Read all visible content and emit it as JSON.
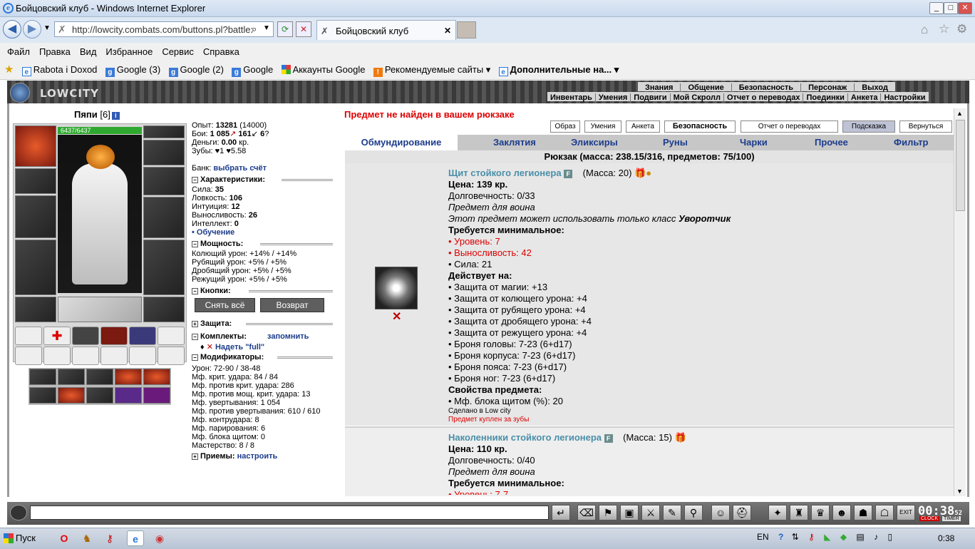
{
  "window": {
    "title": "Бойцовский клуб - Windows Internet Explorer",
    "min": "_",
    "max": "□",
    "close": "✕"
  },
  "browser": {
    "url": "http://lowcity.combats.com/buttons.pl?battle:",
    "tab": "Бойцовский клуб",
    "tab_close": "✕"
  },
  "menu": [
    "Файл",
    "Правка",
    "Вид",
    "Избранное",
    "Сервис",
    "Справка"
  ],
  "favorites": [
    {
      "label": "Rabota i Doxod",
      "icon": "page-icon"
    },
    {
      "label": "Google (3)",
      "icon": "google-icon"
    },
    {
      "label": "Google (2)",
      "icon": "google-icon"
    },
    {
      "label": "Google",
      "icon": "google-icon"
    },
    {
      "label": "Аккаунты Google",
      "icon": "google-accounts-icon"
    },
    {
      "label": "Рекомендуемые сайты ▾",
      "icon": "suggested-sites-icon"
    },
    {
      "label": "Дополнительные на...",
      "icon": "page-icon"
    }
  ],
  "game": {
    "logo": "LOWCITY",
    "top_menu": [
      "Знания",
      "Общение",
      "Безопасность",
      "Персонаж",
      "Выход"
    ],
    "sub_menu": [
      "Инвентарь",
      "Умения",
      "Подвиги",
      "Мой Скролл",
      "Отчет о переводах",
      "Поединки",
      "Анкета",
      "Настройки"
    ]
  },
  "character": {
    "name": "Пяпи",
    "level": "[6]",
    "hp": "6437/6437",
    "stats": {
      "exp_label": "Опыт:",
      "exp": "13281",
      "exp_next": "(14000)",
      "fights_label": "Бои:",
      "wins": "1 085",
      "losses": "161",
      "draws": "6",
      "money_label": "Деньги:",
      "money": "0.00",
      "money_unit": "кр.",
      "teeth_label": "Зубы:",
      "teeth": "1",
      "teeth2": "5.58",
      "bank_label": "Банк:",
      "bank_link": "выбрать счёт"
    },
    "sections": {
      "characteristics": "Характеристики:",
      "power": "Мощность:",
      "buttons": "Кнопки:",
      "defence": "Защита:",
      "sets": "Комплекты:",
      "sets_link": "запомнить",
      "wear_full": "Надеть \"full\"",
      "modifiers": "Модификаторы:",
      "techniques": "Приемы:",
      "techniques_link": "настроить"
    },
    "characteristics": [
      {
        "label": "Сила:",
        "value": "35"
      },
      {
        "label": "Ловкость:",
        "value": "106"
      },
      {
        "label": "Интуиция:",
        "value": "12"
      },
      {
        "label": "Выносливость:",
        "value": "26"
      },
      {
        "label": "Интеллект:",
        "value": "0"
      }
    ],
    "training_link": "• Обучение",
    "power": [
      "Колющий урон: +14% / +14%",
      "Рубящий урон: +5% / +5%",
      "Дробящий урон: +5% / +5%",
      "Режущий урон: +5% / +5%"
    ],
    "btn_remove_all": "Снять всё",
    "btn_return": "Возврат",
    "modifiers": [
      "Урон: 72-90 / 38-48",
      "Мф. крит. удара: 84 / 84",
      "Мф. против крит. удара: 286",
      "Мф. против мощ. крит. удара: 13",
      "Мф. увертывания: 1 054",
      "Мф. против увертывания: 610 / 610",
      "Мф. контрудара: 8",
      "Мф. парирования: 6",
      "Мф. блока щитом: 0",
      "Мастерство: 8 / 8"
    ]
  },
  "main": {
    "message": "Предмет не найден в вашем рюкзаке",
    "top_buttons": [
      "Образ",
      "Умения",
      "Анкета",
      "Безопасность",
      "Отчет о переводах",
      "Подсказка",
      "Вернуться"
    ],
    "categories": [
      "Обмундирование",
      "Заклятия",
      "Эликсиры",
      "Руны",
      "Чарки",
      "Прочее",
      "Фильтр"
    ],
    "rucksack": "Рюкзак (масса: 238.15/316, предметов: 75/100)",
    "item1": {
      "name": "Щит стойкого легионера",
      "f": "F",
      "mass": "(Масса: 20)",
      "price": "Цена: 139 кр.",
      "durability": "Долговечность: 0/33",
      "for": "Предмет для воина",
      "class_prefix": "Этот предмет может использовать только класс",
      "class": "Уворотчик",
      "req_title": "Требуется минимальное:",
      "req": [
        {
          "t": "• Уровень: 7",
          "red": true
        },
        {
          "t": "• Выносливость: 42",
          "red": true
        },
        {
          "t": "• Сила: 21",
          "red": false
        }
      ],
      "acts_title": "Действует на:",
      "acts": [
        "• Защита от магии: +13",
        "• Защита от колющего урона: +4",
        "• Защита от рубящего урона: +4",
        "• Защита от дробящего урона: +4",
        "• Защита от режущего урона: +4",
        "• Броня головы: 7-23 (6+d17)",
        "• Броня корпуса: 7-23 (6+d17)",
        "• Броня пояса: 7-23 (6+d17)",
        "• Броня ног: 7-23 (6+d17)"
      ],
      "props_title": "Свойства предмета:",
      "props": [
        "• Мф. блока щитом (%): 20"
      ],
      "made": "Сделано в Low city",
      "bought": "Предмет куплен за зубы"
    },
    "item2": {
      "name": "Наколенники стойкого легионера",
      "f": "F",
      "mass": "(Масса: 15)",
      "price": "Цена: 110 кр.",
      "durability": "Долговечность: 0/40",
      "for": "Предмет для воина",
      "req_title": "Требуется минимальное:",
      "req_first": "• Уровень: 7-7"
    }
  },
  "chatbar": {
    "clock": "00:38",
    "clock_sec": "52",
    "clock_label": "CLOCK",
    "timer_label": "TIMER",
    "exit_label": "EXIT"
  },
  "taskbar": {
    "start": "Пуск",
    "lang": "EN",
    "time": "0:38"
  }
}
